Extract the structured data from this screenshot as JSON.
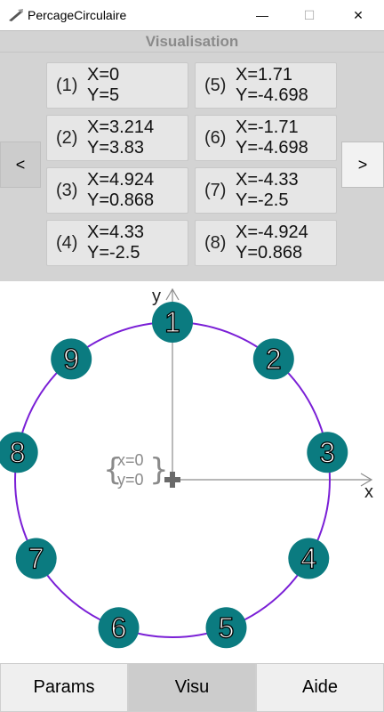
{
  "window": {
    "title": "PercageCirculaire",
    "minimize": "—",
    "maximize": "☐",
    "close": "✕"
  },
  "panel": {
    "title": "Visualisation",
    "prev_label": "<",
    "next_label": ">",
    "coords": [
      {
        "index": "(1)",
        "x": "X=0",
        "y": "Y=5"
      },
      {
        "index": "(2)",
        "x": "X=3.214",
        "y": "Y=3.83"
      },
      {
        "index": "(3)",
        "x": "X=4.924",
        "y": "Y=0.868"
      },
      {
        "index": "(4)",
        "x": "X=4.33",
        "y": "Y=-2.5"
      },
      {
        "index": "(5)",
        "x": "X=1.71",
        "y": "Y=-4.698"
      },
      {
        "index": "(6)",
        "x": "X=-1.71",
        "y": "Y=-4.698"
      },
      {
        "index": "(7)",
        "x": "X=-4.33",
        "y": "Y=-2.5"
      },
      {
        "index": "(8)",
        "x": "X=-4.924",
        "y": "Y=0.868"
      }
    ]
  },
  "diagram": {
    "axis_x_label": "x",
    "axis_y_label": "y",
    "origin_x": "x=0",
    "origin_y": "y=0",
    "hole_count": 9,
    "hole_labels": [
      "1",
      "2",
      "3",
      "4",
      "5",
      "6",
      "7",
      "8",
      "9"
    ],
    "circle_color": "#7a1fd6",
    "hole_color": "#0b7b80"
  },
  "tabs": [
    {
      "label": "Params",
      "active": false
    },
    {
      "label": "Visu",
      "active": true
    },
    {
      "label": "Aide",
      "active": false
    }
  ]
}
